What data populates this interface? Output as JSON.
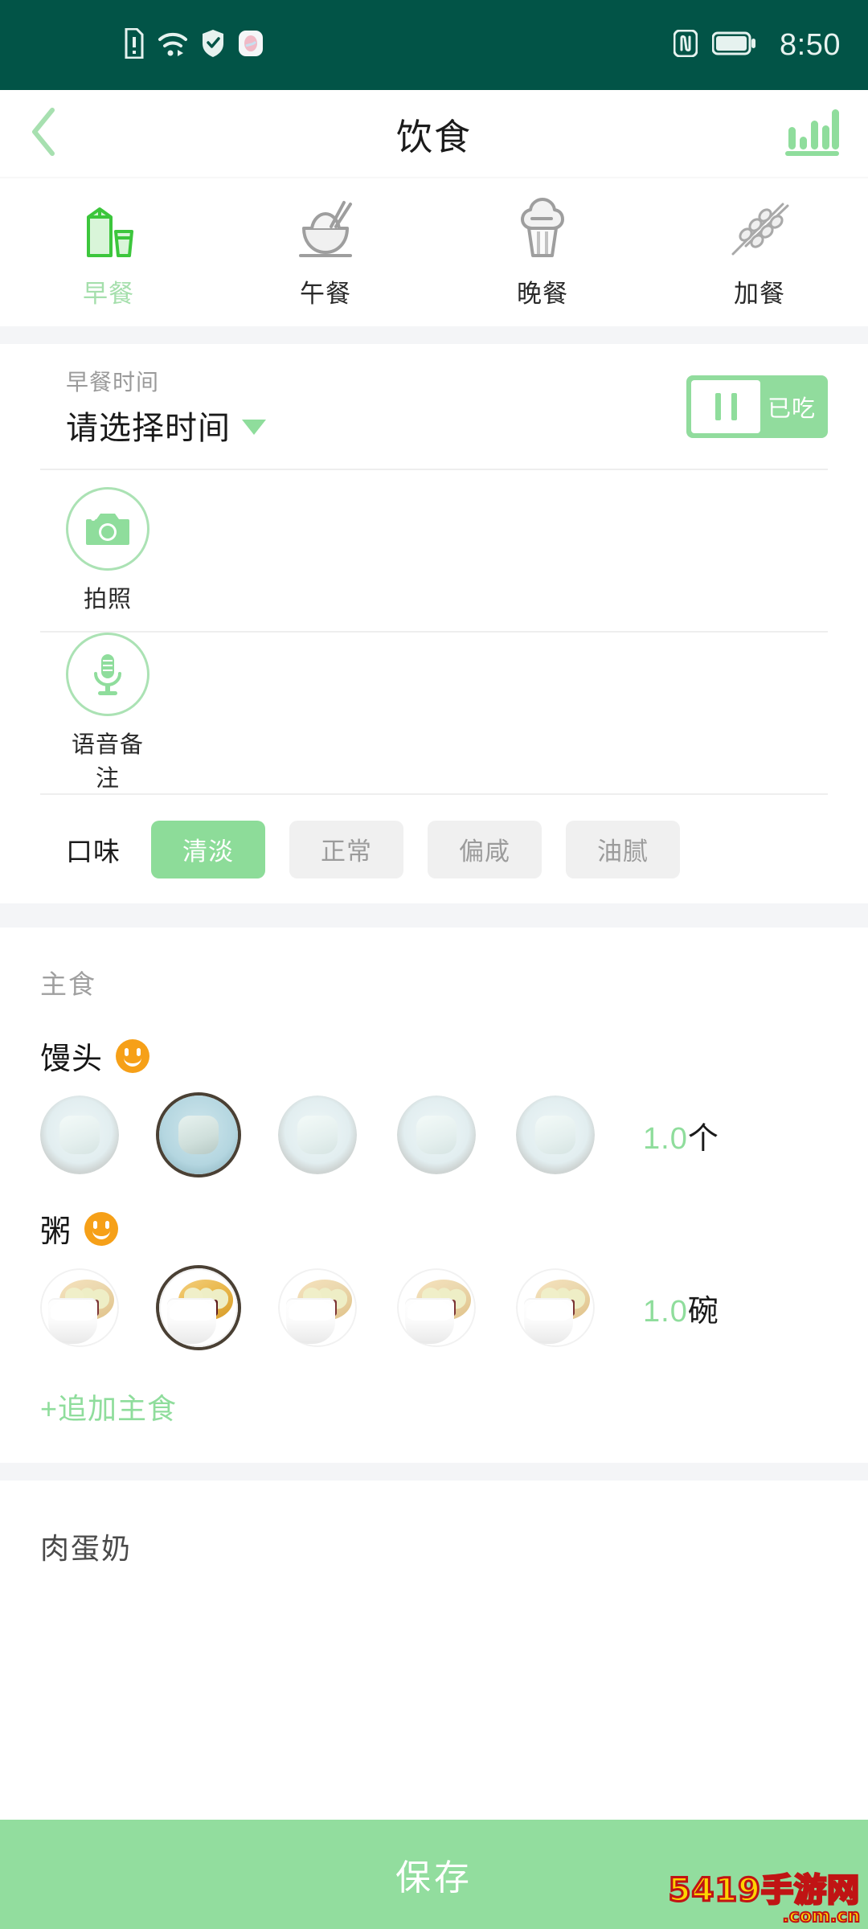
{
  "statusbar": {
    "time": "8:50",
    "icons": [
      "sim-alert-icon",
      "wifi-icon",
      "shield-check-icon",
      "app-icon",
      "nfc-icon",
      "battery-icon"
    ],
    "background_color": "#025447"
  },
  "header": {
    "title": "饮食",
    "back_icon": "chevron-left-icon",
    "chart_icon": "bar-chart-icon",
    "accent_color": "#8fdd9c"
  },
  "meal_tabs": [
    {
      "label": "早餐",
      "icon": "milk-carton-icon",
      "active": true
    },
    {
      "label": "午餐",
      "icon": "rice-bowl-icon",
      "active": false
    },
    {
      "label": "晚餐",
      "icon": "cupcake-icon",
      "active": false
    },
    {
      "label": "加餐",
      "icon": "wheat-skewer-icon",
      "active": false
    }
  ],
  "form": {
    "time_label": "早餐时间",
    "time_value": "请选择时间",
    "time_caret_icon": "caret-down-icon",
    "eaten_toggle": {
      "text": "已吃",
      "state": "on",
      "thumb_icon": "pause-bars-icon"
    },
    "photo": {
      "label": "拍照",
      "icon": "camera-icon"
    },
    "voice": {
      "label": "语音备注",
      "icon": "microphone-icon"
    },
    "taste_label": "口味",
    "taste_options": [
      {
        "label": "清淡",
        "selected": true
      },
      {
        "label": "正常",
        "selected": false
      },
      {
        "label": "偏咸",
        "selected": false
      },
      {
        "label": "油腻",
        "selected": false
      }
    ]
  },
  "sections": [
    {
      "title": "主食",
      "items": [
        {
          "name": "馒头",
          "mood_icon": "smiley-icon",
          "portion_count": 5,
          "selected_index": 1,
          "amount_number": "1.0",
          "amount_unit": "个",
          "thumb_style": "bun"
        },
        {
          "name": "粥",
          "mood_icon": "smiley-icon",
          "portion_count": 5,
          "selected_index": 1,
          "amount_number": "1.0",
          "amount_unit": "碗",
          "thumb_style": "congee"
        }
      ],
      "add_label": "+追加主食"
    },
    {
      "title": "肉蛋奶",
      "items": [],
      "add_label": ""
    }
  ],
  "save_button": {
    "label": "保存",
    "color": "#92dd9e"
  },
  "watermark": {
    "main": "5419手游网",
    "sub": ".com.cn"
  }
}
